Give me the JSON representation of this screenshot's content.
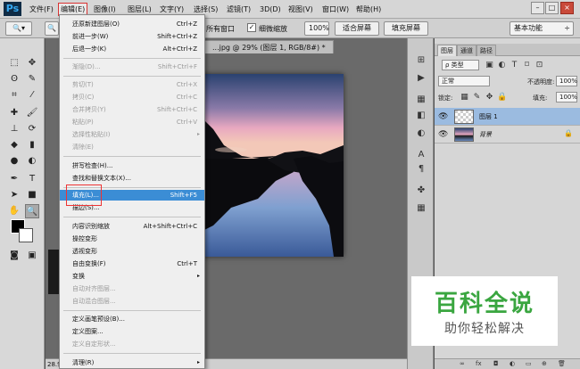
{
  "app": {
    "logo": "Ps"
  },
  "menubar": {
    "items": [
      "文件(F)",
      "编辑(E)",
      "图像(I)",
      "图层(L)",
      "文字(Y)",
      "选择(S)",
      "滤镜(T)",
      "3D(D)",
      "视图(V)",
      "窗口(W)",
      "帮助(H)"
    ],
    "active_index": 1,
    "window_buttons": [
      "–",
      "□",
      "×"
    ]
  },
  "optbar": {
    "all_windows_label": "所有窗口",
    "scrubby_zoom_label": "细微缩放",
    "zoom_value": "100%",
    "fit_screen": "适合屏幕",
    "fill_screen": "填充屏幕",
    "workspace": "基本功能"
  },
  "document": {
    "tab_title": "...jpg @ 29% (图层 1, RGB/8#) *",
    "status_zoom": "28.9"
  },
  "edit_menu": {
    "items": [
      {
        "label": "还原新建图层(O)",
        "shortcut": "Ctrl+Z",
        "disabled": false
      },
      {
        "label": "前进一步(W)",
        "shortcut": "Shift+Ctrl+Z",
        "disabled": false
      },
      {
        "label": "后退一步(K)",
        "shortcut": "Alt+Ctrl+Z",
        "disabled": false
      },
      {
        "sep": true
      },
      {
        "label": "渐隐(D)...",
        "shortcut": "Shift+Ctrl+F",
        "disabled": true
      },
      {
        "sep": true
      },
      {
        "label": "剪切(T)",
        "shortcut": "Ctrl+X",
        "disabled": true
      },
      {
        "label": "拷贝(C)",
        "shortcut": "Ctrl+C",
        "disabled": true
      },
      {
        "label": "合并拷贝(Y)",
        "shortcut": "Shift+Ctrl+C",
        "disabled": true
      },
      {
        "label": "粘贴(P)",
        "shortcut": "Ctrl+V",
        "disabled": true
      },
      {
        "label": "选择性粘贴(I)",
        "shortcut": "",
        "submenu": true,
        "disabled": true
      },
      {
        "label": "清除(E)",
        "shortcut": "",
        "disabled": true
      },
      {
        "sep": true
      },
      {
        "label": "拼写检查(H)...",
        "shortcut": "",
        "disabled": false
      },
      {
        "label": "查找和替换文本(X)...",
        "shortcut": "",
        "disabled": false
      },
      {
        "sep": true
      },
      {
        "label": "填充(L)...",
        "shortcut": "Shift+F5",
        "disabled": false,
        "highlight": true
      },
      {
        "label": "描边(S)...",
        "shortcut": "",
        "disabled": false
      },
      {
        "sep": true
      },
      {
        "label": "内容识别缩放",
        "shortcut": "Alt+Shift+Ctrl+C",
        "disabled": false
      },
      {
        "label": "操控变形",
        "shortcut": "",
        "disabled": false
      },
      {
        "label": "透视变形",
        "shortcut": "",
        "disabled": false
      },
      {
        "label": "自由变换(F)",
        "shortcut": "Ctrl+T",
        "disabled": false
      },
      {
        "label": "变换",
        "shortcut": "",
        "submenu": true,
        "disabled": false
      },
      {
        "label": "自动对齐图层...",
        "shortcut": "",
        "disabled": true
      },
      {
        "label": "自动混合图层...",
        "shortcut": "",
        "disabled": true
      },
      {
        "sep": true
      },
      {
        "label": "定义画笔预设(B)...",
        "shortcut": "",
        "disabled": false
      },
      {
        "label": "定义图案...",
        "shortcut": "",
        "disabled": false
      },
      {
        "label": "定义自定形状...",
        "shortcut": "",
        "disabled": true
      },
      {
        "sep": true
      },
      {
        "label": "清理(R)",
        "shortcut": "",
        "submenu": true,
        "disabled": false
      }
    ]
  },
  "layers_panel": {
    "tabs": [
      "图层",
      "通道",
      "路径"
    ],
    "kind_filter": "ρ 类型",
    "blend_mode": "正常",
    "opacity_label": "不透明度:",
    "opacity_value": "100%",
    "lock_label": "锁定:",
    "fill_label": "填充:",
    "fill_value": "100%",
    "layers": [
      {
        "name": "图层 1",
        "selected": true,
        "locked": false
      },
      {
        "name": "背景",
        "selected": false,
        "locked": true
      }
    ],
    "footer_icons": [
      "link-icon",
      "fx-icon",
      "mask-icon",
      "adjustment-icon",
      "folder-icon",
      "new-layer-icon",
      "trash-icon"
    ]
  },
  "watermark": {
    "title": "百科全说",
    "subtitle": "助你轻松解决"
  },
  "colors": {
    "highlight": "#3b8dd5",
    "menu_outline": "#d93333",
    "watermark_green": "#3aa640"
  }
}
